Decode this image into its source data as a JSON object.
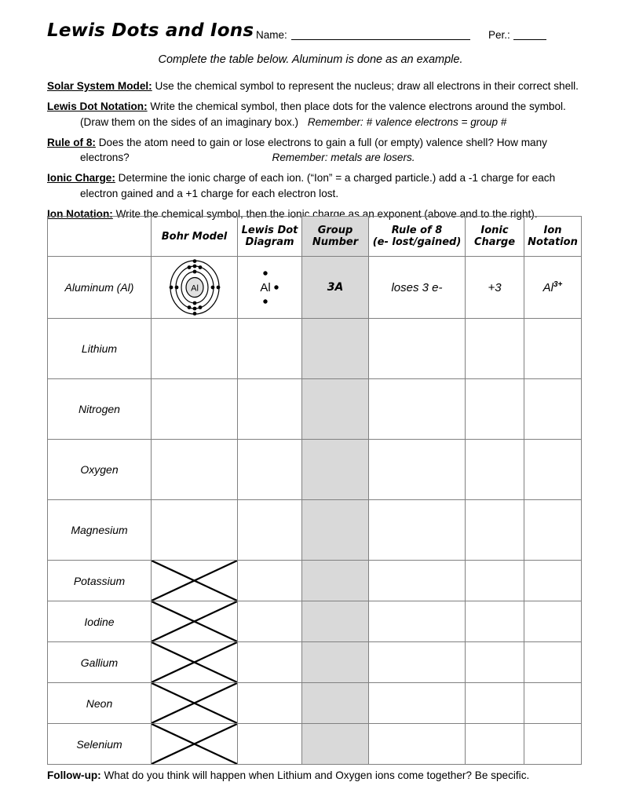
{
  "header": {
    "title": "Lewis Dots and Ions",
    "name_label": "Name:",
    "per_label": "Per.:",
    "subtitle": "Complete the table below.  Aluminum is done as an example."
  },
  "instructions": [
    {
      "heading": "Solar System Model:",
      "body": "Use the chemical symbol to represent the nucleus; draw all electrons in their correct shell."
    },
    {
      "heading": "Lewis Dot Notation:",
      "body": "Write the chemical symbol, then place dots for the valence electrons around the symbol.",
      "indent": "(Draw them on the sides of an imaginary box.)",
      "indent_italic": "Remember: # valence electrons = group #"
    },
    {
      "heading": "Rule of 8:",
      "body": "Does the atom need to gain or lose electrons to gain a full (or empty) valence shell?  How many",
      "indent": "electrons?",
      "indent_italic": "Remember: metals are losers."
    },
    {
      "heading": "Ionic Charge:",
      "body": "Determine the ionic charge of each ion.  (“Ion” = a charged particle.)  add a -1 charge for each",
      "indent": "electron gained and a +1 charge for each electron lost."
    },
    {
      "heading": "Ion Notation:",
      "body": "Write the chemical symbol, then the ionic charge as an exponent (above and to the right)."
    }
  ],
  "table": {
    "headers": [
      {
        "line1": "",
        "line2": ""
      },
      {
        "line1": "Bohr Model",
        "line2": ""
      },
      {
        "line1": "Lewis Dot",
        "line2": "Diagram"
      },
      {
        "line1": "Group",
        "line2": "Number"
      },
      {
        "line1": "Rule of 8",
        "line2": "(e- lost/gained)"
      },
      {
        "line1": "Ionic",
        "line2": "Charge"
      },
      {
        "line1": "Ion",
        "line2": "Notation"
      }
    ],
    "shaded_column_index": 3,
    "shaded_color": "#d9d9d9",
    "example_row": {
      "name": "Aluminum (Al)",
      "bohr_symbol": "Al",
      "bohr_shells": [
        2,
        8,
        3
      ],
      "lewis_symbol": "Al",
      "lewis_dots": [
        "top",
        "right",
        "bottom"
      ],
      "group_number": "3A",
      "rule_of_8": "loses 3 e-",
      "ionic_charge": "+3",
      "ion_notation_base": "Al",
      "ion_notation_sup": "3+"
    },
    "rows": [
      {
        "name": "Lithium",
        "size": "tall",
        "crossout": false
      },
      {
        "name": "Nitrogen",
        "size": "tall",
        "crossout": false
      },
      {
        "name": "Oxygen",
        "size": "tall",
        "crossout": false
      },
      {
        "name": "Magnesium",
        "size": "tall",
        "crossout": false
      },
      {
        "name": "Potassium",
        "size": "short",
        "crossout": true
      },
      {
        "name": "Iodine",
        "size": "short",
        "crossout": true
      },
      {
        "name": "Gallium",
        "size": "short",
        "crossout": true
      },
      {
        "name": "Neon",
        "size": "short",
        "crossout": true
      },
      {
        "name": "Selenium",
        "size": "short",
        "crossout": true
      }
    ]
  },
  "followup": {
    "label": "Follow-up:",
    "text": "What do you think will happen when Lithium and Oxygen ions come together?  Be specific."
  }
}
